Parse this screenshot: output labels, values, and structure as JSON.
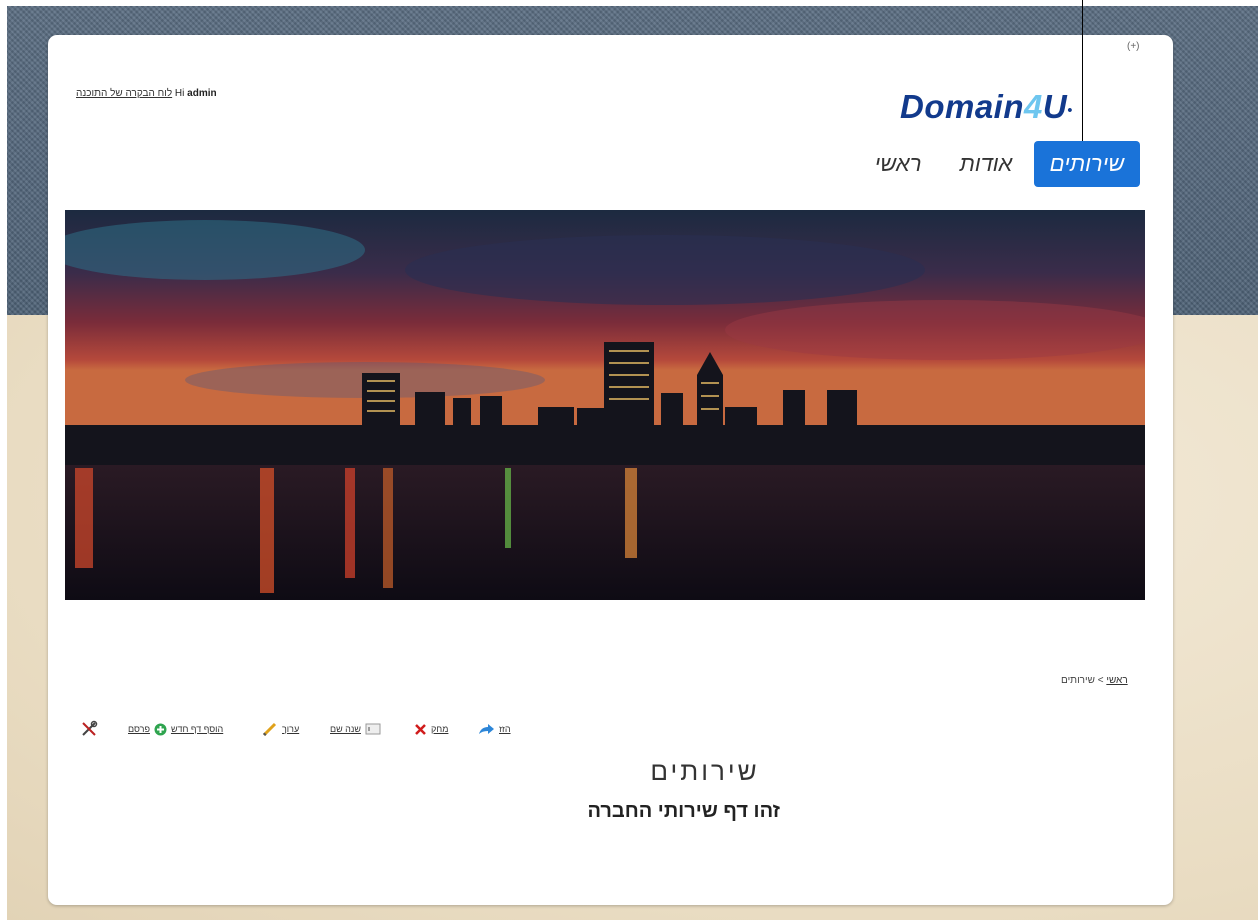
{
  "header": {
    "top_badge": "(+)",
    "greeting_hi": "Hi",
    "greeting_user": "admin",
    "admin_link": "לוח הבקרה של התוכנה",
    "logo_part1": "Domain",
    "logo_part2": "4",
    "logo_part3": "U",
    "logo_dot": "•"
  },
  "nav": {
    "items": [
      {
        "label": "שירותים",
        "active": true
      },
      {
        "label": "אודות",
        "active": false
      },
      {
        "label": "ראשי",
        "active": false
      }
    ]
  },
  "breadcrumb": {
    "home": "ראשי",
    "separator": ">",
    "current": "שירותים"
  },
  "toolbar": {
    "move": "הזז",
    "delete": "מחק",
    "rename": "שנה שם",
    "edit": "ערוך",
    "add_page": "הוסף דף חדש",
    "save": "פרסם"
  },
  "page": {
    "title": "שירותים",
    "subtitle": "זהו דף שירותי החברה"
  },
  "colors": {
    "accent": "#1a73d9",
    "logo_primary": "#123a8c",
    "logo_accent": "#6ec6ef"
  }
}
